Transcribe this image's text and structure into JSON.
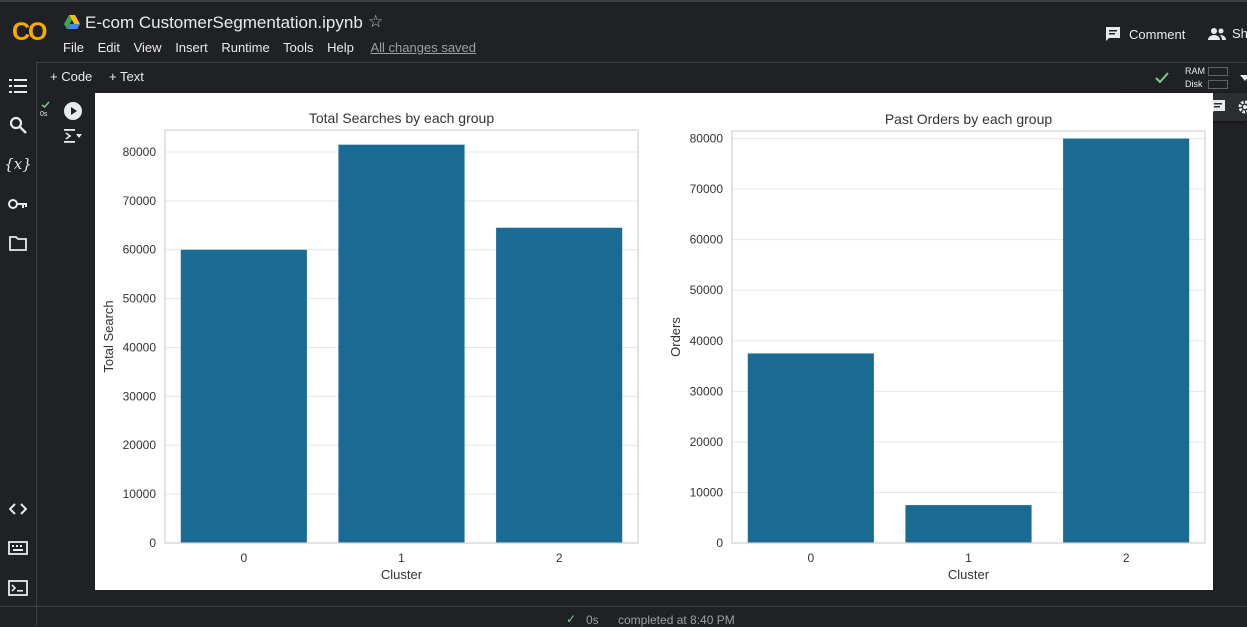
{
  "app": {
    "logo_text": "CO",
    "notebook_title": "E-com CustomerSegmentation.ipynb",
    "menu": [
      "File",
      "Edit",
      "View",
      "Insert",
      "Runtime",
      "Tools",
      "Help"
    ],
    "save_status": "All changes saved",
    "comment_label": "Comment",
    "share_label": "Sh"
  },
  "toolbar": {
    "add_code_label": "+ Code",
    "add_text_label": "+ Text",
    "ram_label": "RAM",
    "disk_label": "Disk"
  },
  "cell": {
    "exec_time": "0s"
  },
  "status": {
    "time": "0s",
    "text": "completed at 8:40 PM"
  },
  "icons": {
    "sidebar": [
      "toc-icon",
      "search-icon",
      "variables-icon",
      "secrets-key-icon",
      "folder-icon",
      "code-snippets-icon",
      "command-palette-icon",
      "terminal-icon"
    ],
    "cell_actions": [
      "move-up-icon",
      "move-down-icon",
      "link-icon",
      "comment-icon",
      "settings-icon"
    ]
  },
  "colors": {
    "bar": "#1a6b94",
    "accent_green": "#81c995",
    "logo_orange": "#f9ab00"
  },
  "chart_data": [
    {
      "type": "bar",
      "title": "Total Searches by each group",
      "xlabel": "Cluster",
      "ylabel": "Total Search",
      "categories": [
        "0",
        "1",
        "2"
      ],
      "values": [
        60000,
        81500,
        64500
      ],
      "ylim": [
        0,
        84500
      ],
      "yticks": [
        0,
        10000,
        20000,
        30000,
        40000,
        50000,
        60000,
        70000,
        80000
      ],
      "grid": true
    },
    {
      "type": "bar",
      "title": "Past Orders by each group",
      "xlabel": "Cluster",
      "ylabel": "Orders",
      "categories": [
        "0",
        "1",
        "2"
      ],
      "values": [
        37500,
        7500,
        80000
      ],
      "ylim": [
        0,
        81500
      ],
      "yticks": [
        0,
        10000,
        20000,
        30000,
        40000,
        50000,
        60000,
        70000,
        80000
      ],
      "grid": true
    }
  ]
}
